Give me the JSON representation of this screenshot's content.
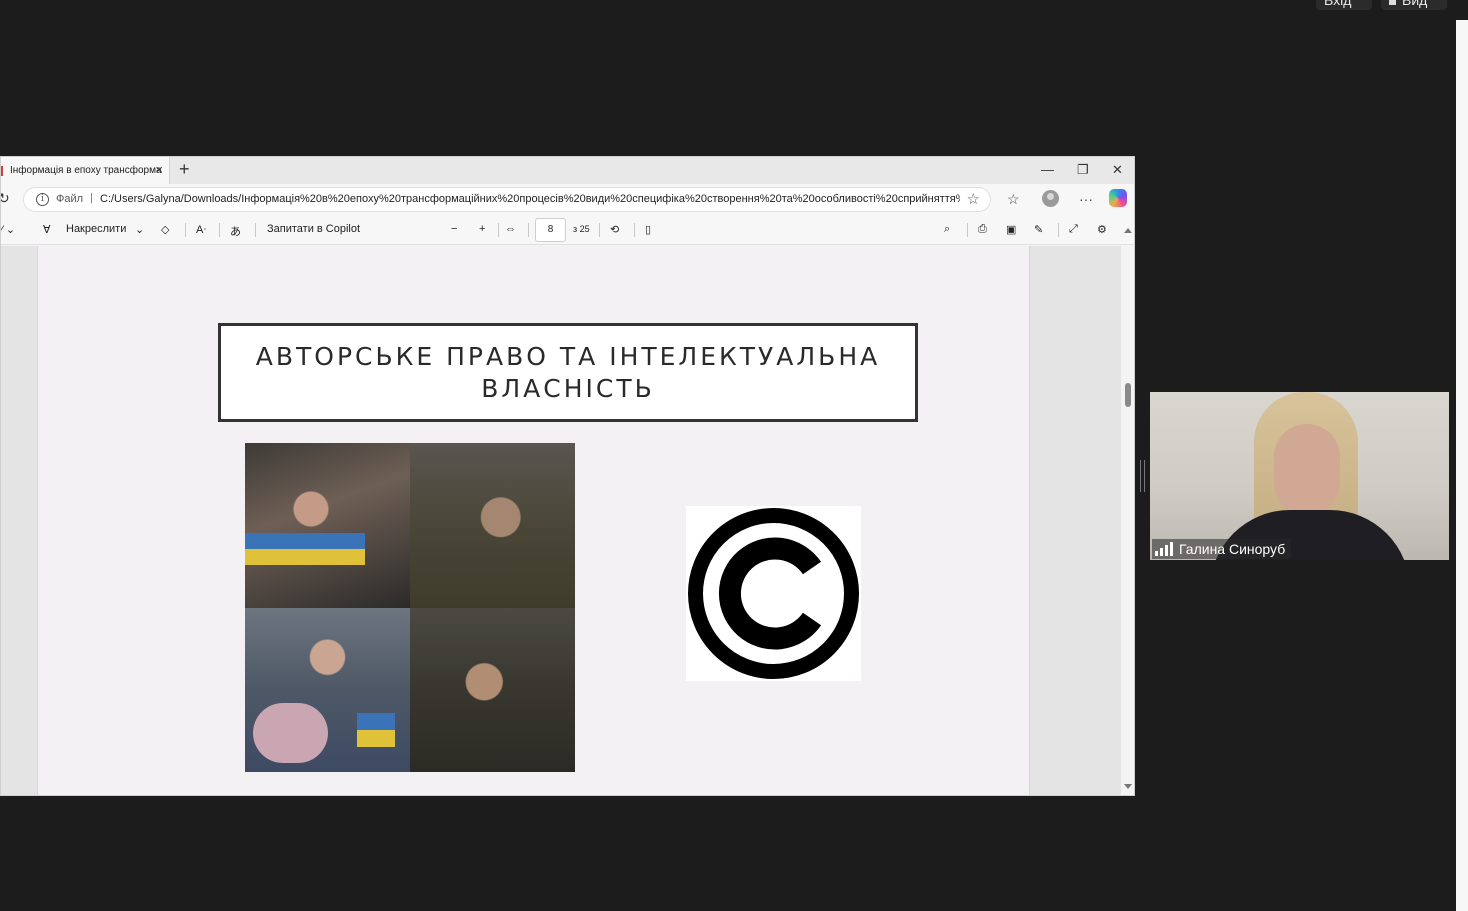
{
  "meeting": {
    "exit_label": "Вхід",
    "view_label": "Вид"
  },
  "browser": {
    "tab_title": "Інформація в епоху трансформа",
    "tab_close": "×",
    "new_tab": "+",
    "file_label": "Файл",
    "url": "C:/Users/Galyna/Downloads/Інформація%20в%20епоху%20трансформаційних%20процесів%20види%20специфіка%20створення%20та%20особливості%20сприйняття%2..."
  },
  "pdf_toolbar": {
    "draw_label": "Накреслити",
    "copilot_label": "Запитати в Copilot",
    "current_page": "8",
    "page_of": "з 25",
    "zoom_out": "−",
    "zoom_in": "+"
  },
  "slide": {
    "title": "АВТОРСЬКЕ ПРАВО ТА ІНТЕЛЕКТУАЛЬНА ВЛАСНІСТЬ"
  },
  "participant": {
    "name": "Галина Синоруб"
  }
}
